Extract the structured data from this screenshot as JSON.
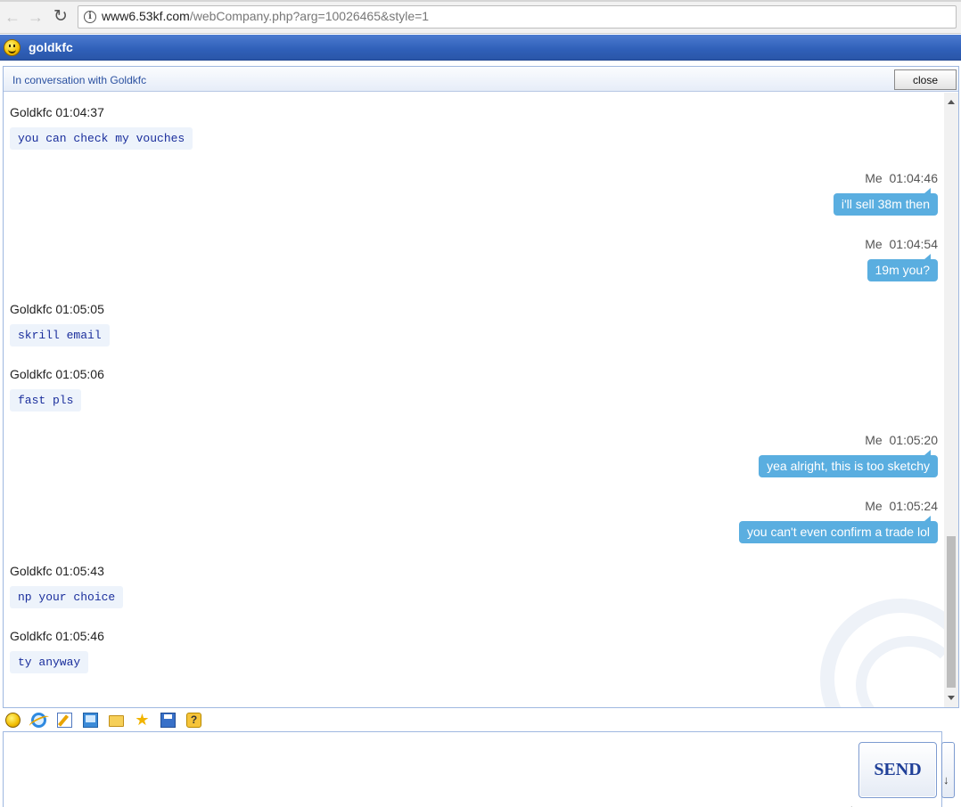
{
  "browser": {
    "url_host": "www6.53kf.com",
    "url_rest": "/webCompany.php?arg=10026465&style=1",
    "back_glyph": "←",
    "forward_glyph": "→",
    "reload_glyph": "↻",
    "info_glyph": "i"
  },
  "window": {
    "title": "goldkfc"
  },
  "conversation": {
    "prefix": "In conversation with ",
    "partner": "Goldkfc",
    "close_label": "close"
  },
  "messages": [
    {
      "sender": "Goldkfc",
      "time": "01:04:37",
      "text": "you can check my vouches",
      "from_me": false
    },
    {
      "sender": "Me",
      "time": "01:04:46",
      "text": "i'll sell 38m then",
      "from_me": true
    },
    {
      "sender": "Me",
      "time": "01:04:54",
      "text": "19m you?",
      "from_me": true
    },
    {
      "sender": "Goldkfc",
      "time": "01:05:05",
      "text": "skrill email",
      "from_me": false
    },
    {
      "sender": "Goldkfc",
      "time": "01:05:06",
      "text": "fast pls",
      "from_me": false
    },
    {
      "sender": "Me",
      "time": "01:05:20",
      "text": "yea alright, this is too sketchy",
      "from_me": true
    },
    {
      "sender": "Me",
      "time": "01:05:24",
      "text": "you can't even confirm a trade lol",
      "from_me": true
    },
    {
      "sender": "Goldkfc",
      "time": "01:05:43",
      "text": "np your choice",
      "from_me": false
    },
    {
      "sender": "Goldkfc",
      "time": "01:05:46",
      "text": "ty anyway",
      "from_me": false
    }
  ],
  "toolbar": {
    "icons": [
      "smiley-icon",
      "ie-icon",
      "edit-icon",
      "screenshot-icon",
      "folder-icon",
      "star-icon",
      "save-icon",
      "help-icon"
    ],
    "star_glyph": "★",
    "help_glyph": "?"
  },
  "input": {
    "value": "",
    "send_label": "SEND"
  },
  "colors": {
    "title_bar": "#2f5fb8",
    "my_bubble": "#5aaee0",
    "their_bubble": "#edf3fb",
    "their_text": "#1a2e9c"
  }
}
